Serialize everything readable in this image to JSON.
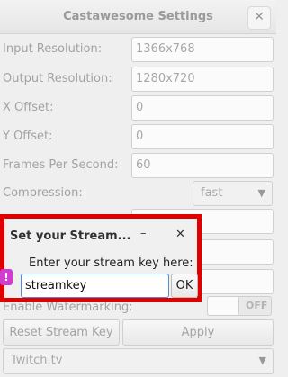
{
  "window": {
    "title": "Castawesome Settings",
    "close_glyph": "✕"
  },
  "fields": {
    "input_resolution": {
      "label": "Input Resolution:",
      "value": "1366x768"
    },
    "output_resolution": {
      "label": "Output Resolution:",
      "value": "1280x720"
    },
    "x_offset": {
      "label": "X Offset:",
      "value": "0"
    },
    "y_offset": {
      "label": "Y Offset:",
      "value": "0"
    },
    "fps": {
      "label": "Frames Per Second:",
      "value": "60"
    },
    "compression": {
      "label": "Compression:",
      "value": "fast"
    },
    "watermarking": {
      "label": "Enable Watermarking:",
      "state": "OFF"
    }
  },
  "buttons": {
    "reset_stream_key": "Reset Stream Key",
    "apply": "Apply"
  },
  "service_select": {
    "value": "Twitch.tv"
  },
  "dialog": {
    "title": "Set your Stream...",
    "minimize_glyph": "–",
    "close_glyph": "✕",
    "prompt": "Enter your stream key here:",
    "input_value": "streamkey",
    "ok_label": "OK",
    "warn_glyph": "!"
  },
  "icons": {
    "chevron": "chevron-down-icon",
    "warning": "warning-icon",
    "close": "close-icon",
    "minimize": "minimize-icon"
  },
  "colors": {
    "highlight_border": "#e00000",
    "focus_blue": "#4a90d9",
    "warning_icon": "#d23cd2"
  }
}
